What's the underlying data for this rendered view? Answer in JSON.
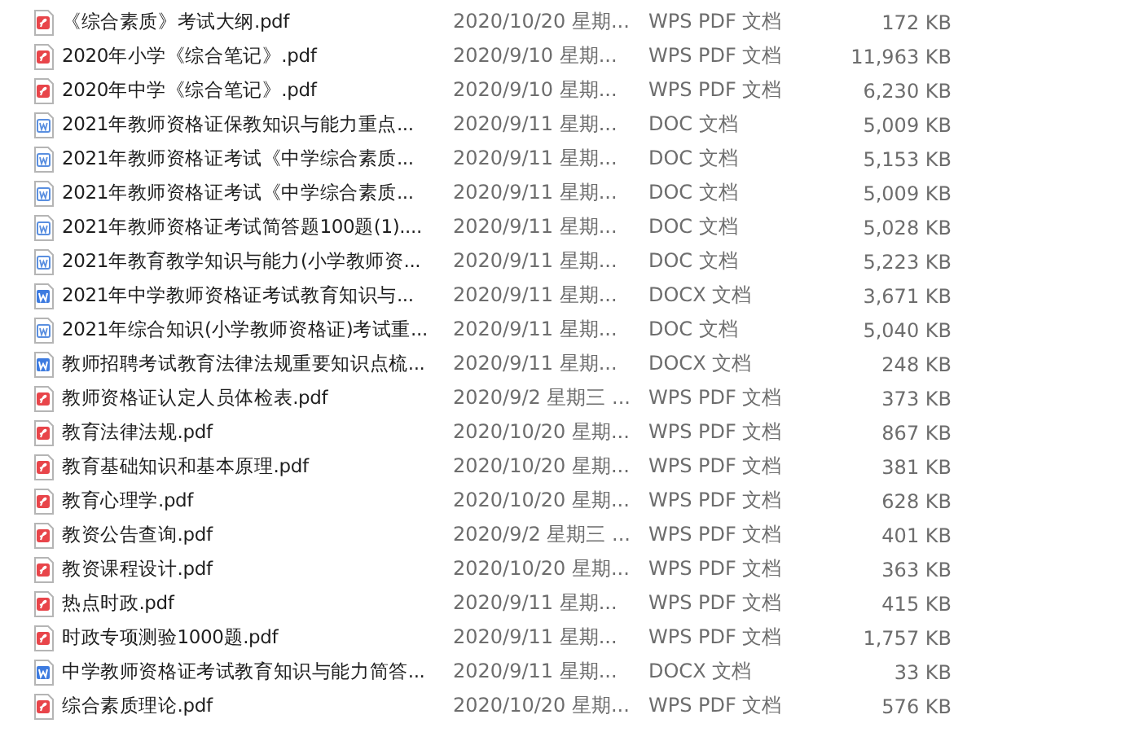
{
  "files": [
    {
      "kind": "pdf",
      "name": "《综合素质》考试大纲.pdf",
      "date": "2020/10/20 星期...",
      "type": "WPS PDF 文档",
      "size": "172 KB"
    },
    {
      "kind": "pdf",
      "name": "2020年小学《综合笔记》.pdf",
      "date": "2020/9/10 星期...",
      "type": "WPS PDF 文档",
      "size": "11,963 KB"
    },
    {
      "kind": "pdf",
      "name": "2020年中学《综合笔记》.pdf",
      "date": "2020/9/10 星期...",
      "type": "WPS PDF 文档",
      "size": "6,230 KB"
    },
    {
      "kind": "doc",
      "name": "2021年教师资格证保教知识与能力重点...",
      "date": "2020/9/11 星期...",
      "type": "DOC 文档",
      "size": "5,009 KB"
    },
    {
      "kind": "doc",
      "name": "2021年教师资格证考试《中学综合素质...",
      "date": "2020/9/11 星期...",
      "type": "DOC 文档",
      "size": "5,153 KB"
    },
    {
      "kind": "doc",
      "name": "2021年教师资格证考试《中学综合素质...",
      "date": "2020/9/11 星期...",
      "type": "DOC 文档",
      "size": "5,009 KB"
    },
    {
      "kind": "doc",
      "name": "2021年教师资格证考试简答题100题(1)....",
      "date": "2020/9/11 星期...",
      "type": "DOC 文档",
      "size": "5,028 KB"
    },
    {
      "kind": "doc",
      "name": "2021年教育教学知识与能力(小学教师资...",
      "date": "2020/9/11 星期...",
      "type": "DOC 文档",
      "size": "5,223 KB"
    },
    {
      "kind": "docx",
      "name": "2021年中学教师资格证考试教育知识与...",
      "date": "2020/9/11 星期...",
      "type": "DOCX 文档",
      "size": "3,671 KB"
    },
    {
      "kind": "doc",
      "name": "2021年综合知识(小学教师资格证)考试重...",
      "date": "2020/9/11 星期...",
      "type": "DOC 文档",
      "size": "5,040 KB"
    },
    {
      "kind": "docx",
      "name": "教师招聘考试教育法律法规重要知识点梳...",
      "date": "2020/9/11 星期...",
      "type": "DOCX 文档",
      "size": "248 KB"
    },
    {
      "kind": "pdf",
      "name": "教师资格证认定人员体检表.pdf",
      "date": "2020/9/2 星期三 ...",
      "type": "WPS PDF 文档",
      "size": "373 KB"
    },
    {
      "kind": "pdf",
      "name": "教育法律法规.pdf",
      "date": "2020/10/20 星期...",
      "type": "WPS PDF 文档",
      "size": "867 KB"
    },
    {
      "kind": "pdf",
      "name": "教育基础知识和基本原理.pdf",
      "date": "2020/10/20 星期...",
      "type": "WPS PDF 文档",
      "size": "381 KB"
    },
    {
      "kind": "pdf",
      "name": "教育心理学.pdf",
      "date": "2020/10/20 星期...",
      "type": "WPS PDF 文档",
      "size": "628 KB"
    },
    {
      "kind": "pdf",
      "name": "教资公告查询.pdf",
      "date": "2020/9/2 星期三 ...",
      "type": "WPS PDF 文档",
      "size": "401 KB"
    },
    {
      "kind": "pdf",
      "name": "教资课程设计.pdf",
      "date": "2020/10/20 星期...",
      "type": "WPS PDF 文档",
      "size": "363 KB"
    },
    {
      "kind": "pdf",
      "name": "热点时政.pdf",
      "date": "2020/9/11 星期...",
      "type": "WPS PDF 文档",
      "size": "415 KB"
    },
    {
      "kind": "pdf",
      "name": "时政专项测验1000题.pdf",
      "date": "2020/9/11 星期...",
      "type": "WPS PDF 文档",
      "size": "1,757 KB"
    },
    {
      "kind": "docx",
      "name": "中学教师资格证考试教育知识与能力简答...",
      "date": "2020/9/11 星期...",
      "type": "DOCX 文档",
      "size": "33 KB"
    },
    {
      "kind": "pdf",
      "name": "综合素质理论.pdf",
      "date": "2020/10/20 星期...",
      "type": "WPS PDF 文档",
      "size": "576 KB"
    }
  ]
}
